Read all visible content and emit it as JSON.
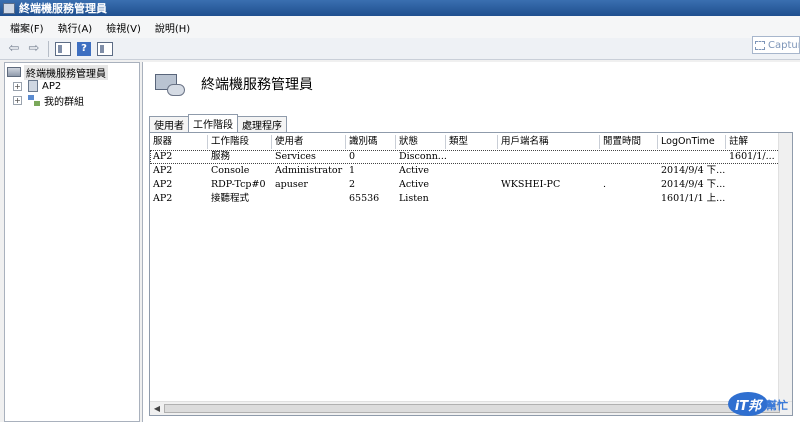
{
  "window": {
    "title": "終端機服務管理員"
  },
  "menu": [
    "檔案(F)",
    "執行(A)",
    "檢視(V)",
    "說明(H)"
  ],
  "capture_label": "Captur",
  "tree": {
    "root": "終端機服務管理員",
    "items": [
      {
        "label": "AP2",
        "expander": "+"
      },
      {
        "label": "我的群組",
        "expander": "+"
      }
    ]
  },
  "content": {
    "title": "終端機服務管理員",
    "tabs": [
      "使用者",
      "工作階段",
      "處理程序"
    ],
    "active_tab": "工作階段",
    "columns": [
      "服器",
      "工作階段",
      "使用者",
      "識別碼",
      "狀態",
      "類型",
      "用戶端名稱",
      "閒置時間",
      "LogOnTime",
      "註解"
    ],
    "rows": [
      [
        "AP2",
        "服務",
        "Services",
        "0",
        "Disconn...",
        "",
        "",
        "",
        "",
        "1601/1/..."
      ],
      [
        "AP2",
        "Console",
        "Administrator",
        "1",
        "Active",
        "",
        "",
        "",
        "2014/9/4 下...",
        ""
      ],
      [
        "AP2",
        "RDP-Tcp#0",
        "apuser",
        "2",
        "Active",
        "",
        "WKSHEI-PC",
        ".",
        "2014/9/4 下...",
        ""
      ],
      [
        "AP2",
        "接聽程式",
        "",
        "65536",
        "Listen",
        "",
        "",
        "",
        "1601/1/1 上...",
        ""
      ]
    ]
  },
  "watermark": {
    "logo": "iT邦",
    "text": "幫忙"
  },
  "scroll_arrow": "◀"
}
